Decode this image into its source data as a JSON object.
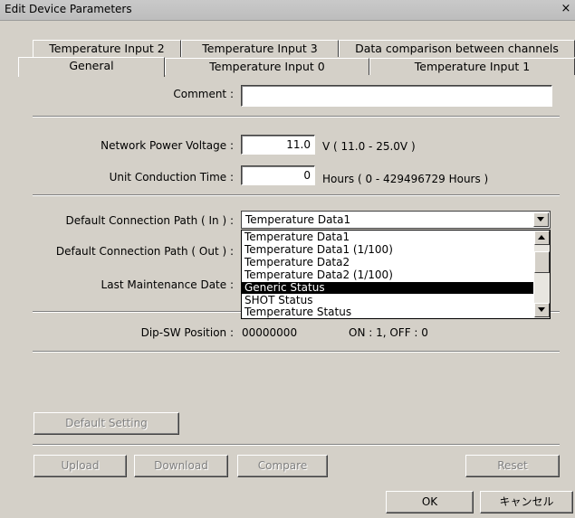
{
  "window": {
    "title": "Edit Device Parameters",
    "close_glyph": "×"
  },
  "tabs": {
    "row1": [
      "Temperature Input 2",
      "Temperature Input 3",
      "Data comparison between channels"
    ],
    "row2": [
      "General",
      "Temperature Input 0",
      "Temperature Input 1"
    ]
  },
  "form": {
    "comment_label": "Comment :",
    "comment_value": "",
    "voltage_label": "Network Power Voltage :",
    "voltage_value": "11.0",
    "voltage_unit": "V ( 11.0 - 25.0V )",
    "time_label": "Unit Conduction Time :",
    "time_value": "0",
    "time_unit": "Hours ( 0 - 429496729 Hours )",
    "path_in_label": "Default Connection Path ( In ) :",
    "path_in_value": "Temperature Data1",
    "path_out_label": "Default Connection Path ( Out ) :",
    "maint_label": "Last Maintenance Date :",
    "dipsw_label": "Dip-SW Position :",
    "dipsw_value": "00000000",
    "dipsw_legend": "ON : 1, OFF : 0"
  },
  "dropdown": {
    "options": [
      "Temperature Data1",
      "Temperature Data1 (1/100)",
      "Temperature Data2",
      "Temperature Data2 (1/100)",
      "Generic Status",
      "SHOT Status",
      "Temperature Status"
    ],
    "selected_index": 4
  },
  "buttons": {
    "default_setting": "Default Setting",
    "upload": "Upload",
    "download": "Download",
    "compare": "Compare",
    "reset": "Reset",
    "ok": "OK",
    "cancel": "キャンセル"
  }
}
